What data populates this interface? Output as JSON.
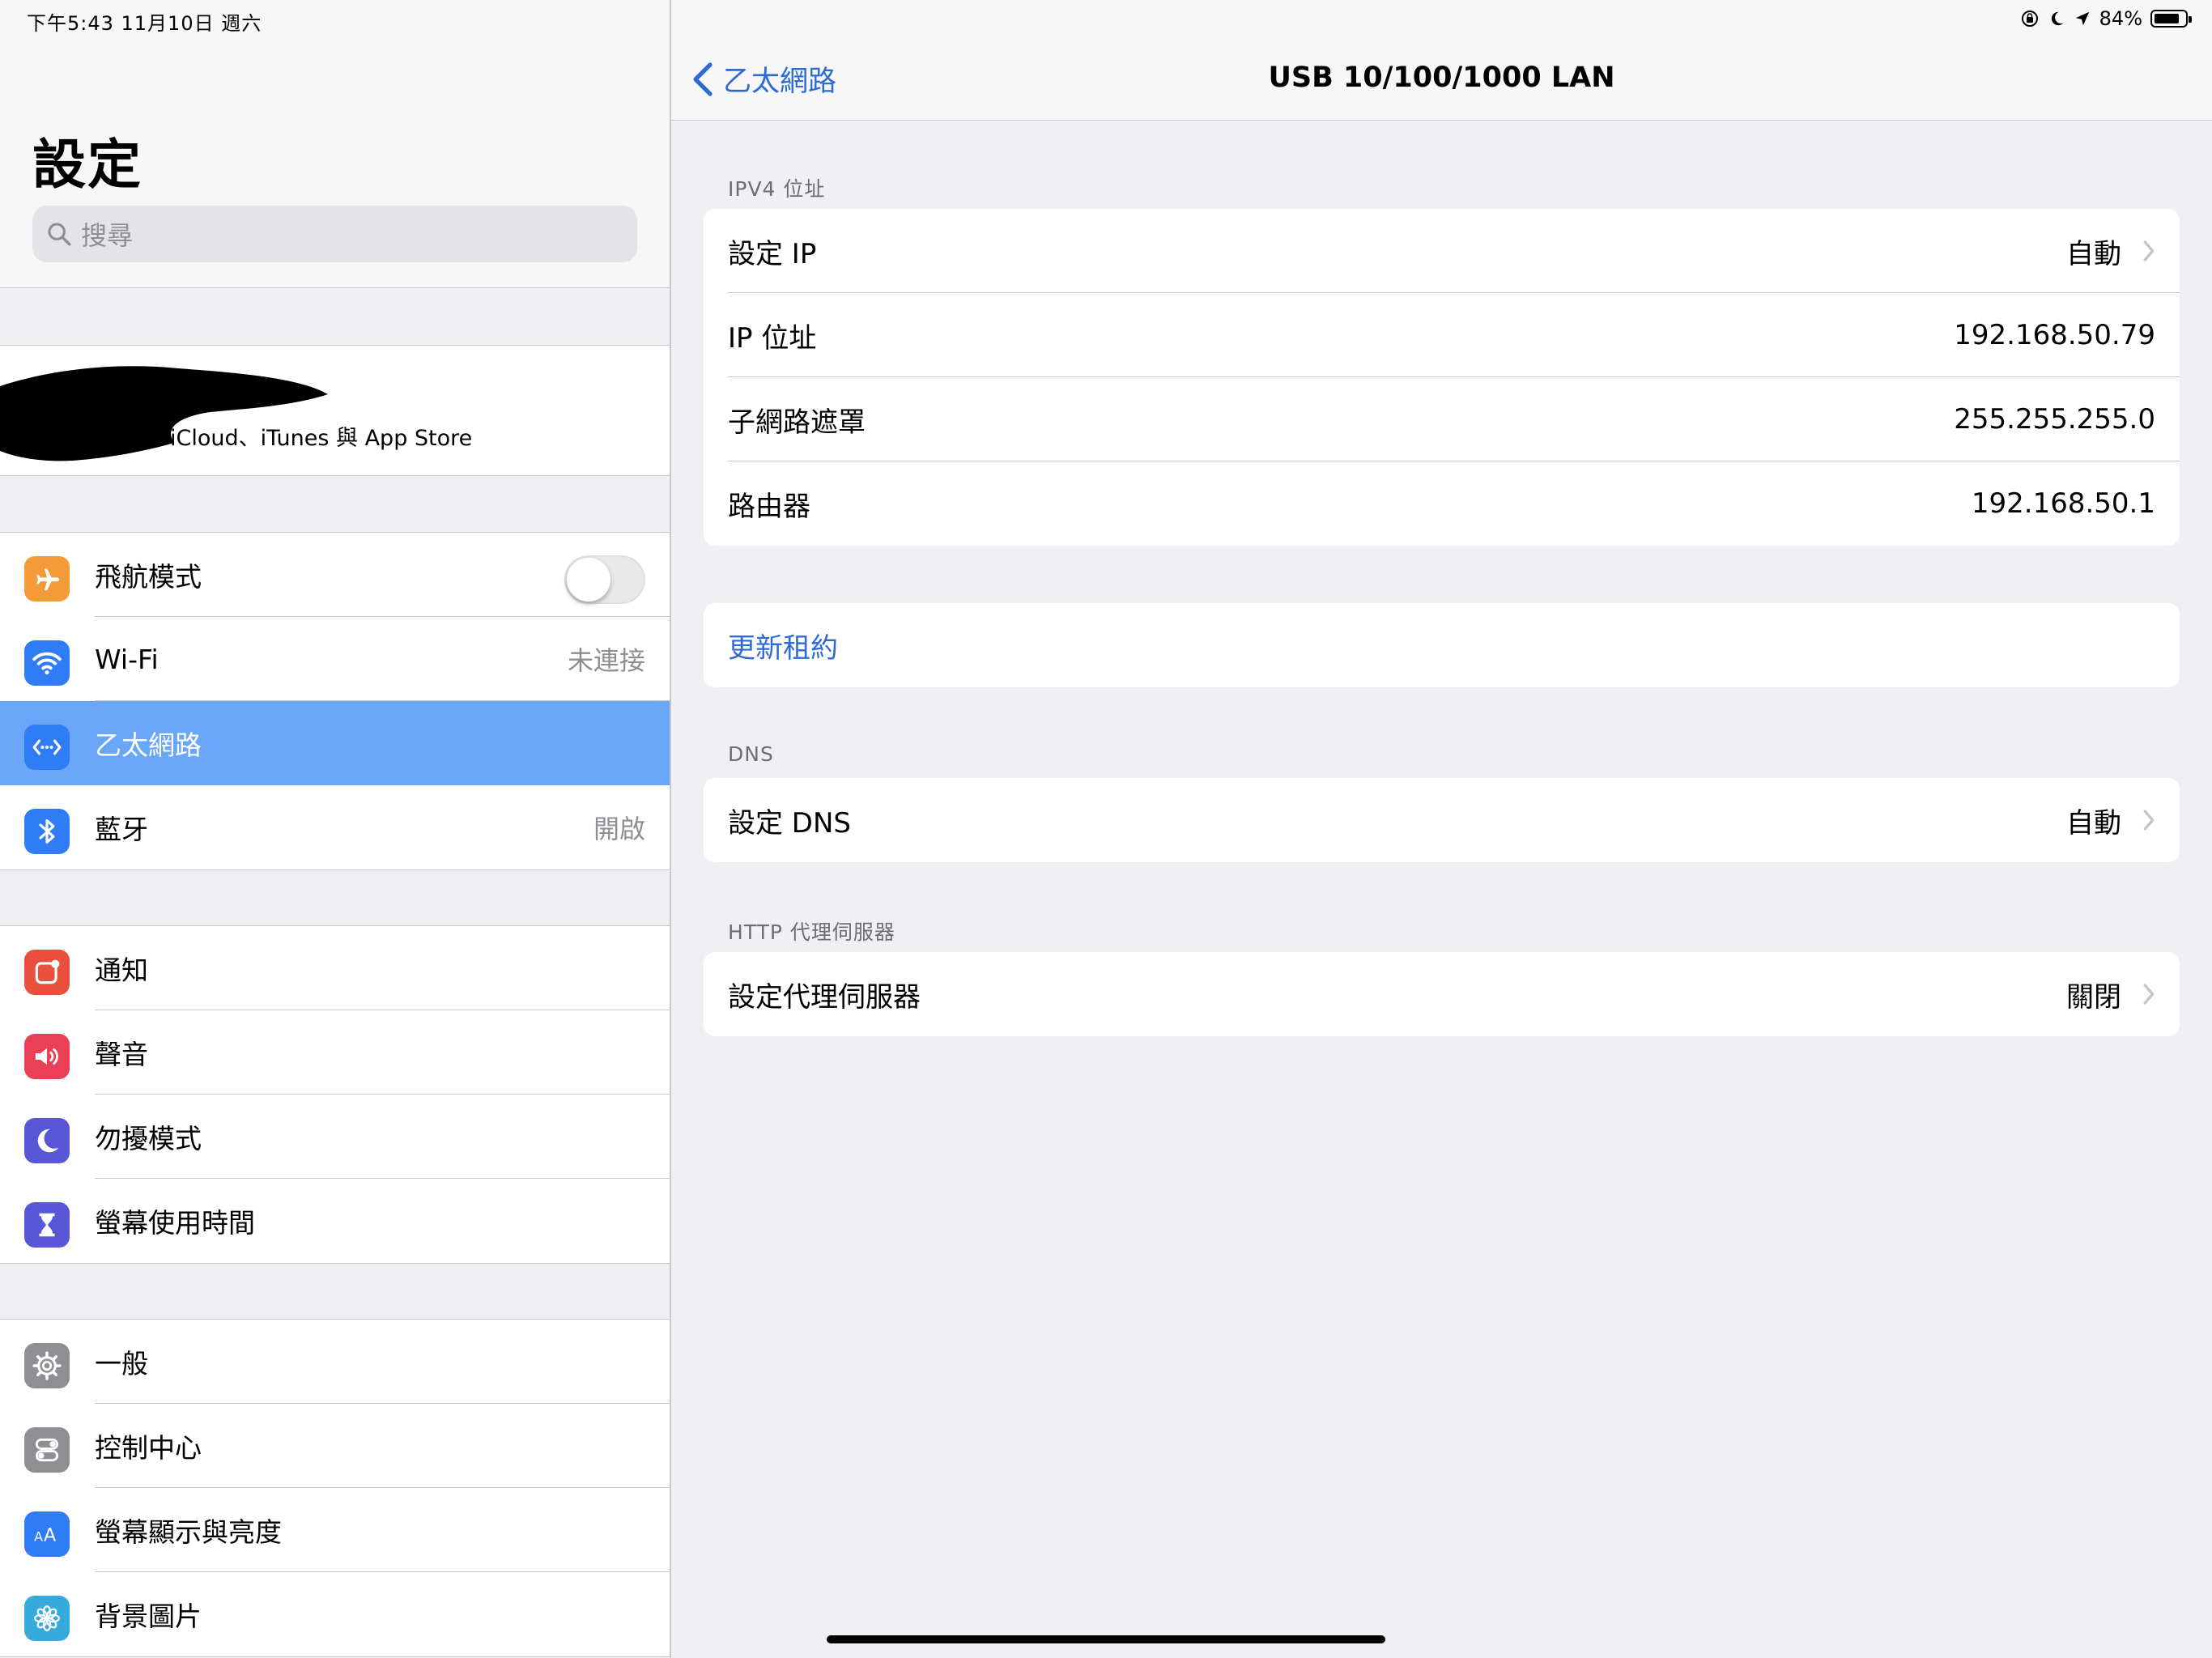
{
  "status_bar": {
    "left": "下午5:43   11月10日 週六",
    "battery": "84%",
    "battery_level": 0.84
  },
  "master": {
    "title": "設定",
    "search_placeholder": "搜尋",
    "profile_subtitle": "iCloud、iTunes 與 App Store",
    "groups": [
      [
        {
          "label": "飛航模式",
          "icon": "airplane-icon",
          "color": "#f29b38",
          "toggle": false
        },
        {
          "label": "Wi-Fi",
          "icon": "wifi-icon",
          "color": "#2f7cf6",
          "value": "未連接"
        },
        {
          "label": "乙太網路",
          "icon": "ethernet-icon",
          "color": "#2f7cf6",
          "selected": true
        },
        {
          "label": "藍牙",
          "icon": "bluetooth-icon",
          "color": "#2f7cf6",
          "value": "開啟"
        }
      ],
      [
        {
          "label": "通知",
          "icon": "notifications-icon",
          "color": "#ea4f3e"
        },
        {
          "label": "聲音",
          "icon": "sound-icon",
          "color": "#ea3f56"
        },
        {
          "label": "勿擾模式",
          "icon": "moon-icon",
          "color": "#5856d6"
        },
        {
          "label": "螢幕使用時間",
          "icon": "hourglass-icon",
          "color": "#5856d6"
        }
      ],
      [
        {
          "label": "一般",
          "icon": "gear-icon",
          "color": "#8e8e93"
        },
        {
          "label": "控制中心",
          "icon": "control-center-icon",
          "color": "#8e8e93"
        },
        {
          "label": "螢幕顯示與亮度",
          "icon": "display-icon",
          "color": "#2f7cf6"
        },
        {
          "label": "背景圖片",
          "icon": "wallpaper-icon",
          "color": "#36aadc"
        }
      ]
    ]
  },
  "detail": {
    "back_label": "乙太網路",
    "title": "USB 10/100/1000 LAN",
    "ipv4_header": "IPV4 位址",
    "ipv4_rows": [
      {
        "label": "設定 IP",
        "value": "自動",
        "chevron": true
      },
      {
        "label": "IP 位址",
        "value": "192.168.50.79"
      },
      {
        "label": "子網路遮罩",
        "value": "255.255.255.0"
      },
      {
        "label": "路由器",
        "value": "192.168.50.1"
      }
    ],
    "renew_lease": "更新租約",
    "dns_header": "DNS",
    "dns_row": {
      "label": "設定 DNS",
      "value": "自動"
    },
    "proxy_header": "HTTP 代理伺服器",
    "proxy_row": {
      "label": "設定代理伺服器",
      "value": "關閉"
    }
  },
  "colors": {
    "accent": "#2e6ad6",
    "selected_row": "#6aa6f8",
    "background": "#efeff4"
  }
}
